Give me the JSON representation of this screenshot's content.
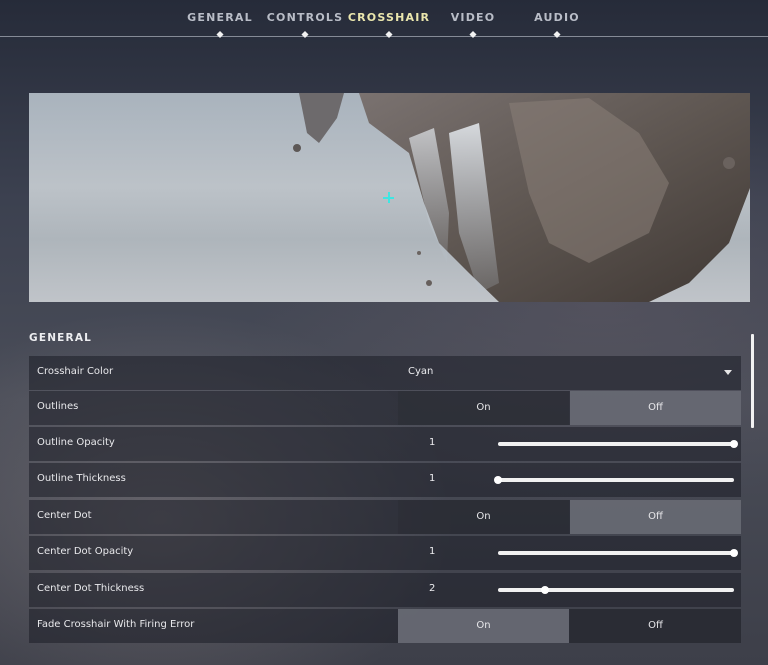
{
  "tabs": [
    {
      "label": "GENERAL",
      "active": false
    },
    {
      "label": "CONTROLS",
      "active": false
    },
    {
      "label": "CROSSHAIR",
      "active": true
    },
    {
      "label": "VIDEO",
      "active": false
    },
    {
      "label": "AUDIO",
      "active": false
    }
  ],
  "crosshair_preview": {
    "crosshair_color": "#3ee6e2"
  },
  "section": {
    "title": "GENERAL"
  },
  "settings": {
    "crosshair_color": {
      "label": "Crosshair Color",
      "value": "Cyan"
    },
    "outlines": {
      "label": "Outlines",
      "on_label": "On",
      "off_label": "Off",
      "selected": "Off"
    },
    "outline_opacity": {
      "label": "Outline Opacity",
      "value": "1",
      "fraction": 1.0
    },
    "outline_thickness": {
      "label": "Outline Thickness",
      "value": "1",
      "fraction": 0.0
    },
    "center_dot": {
      "label": "Center Dot",
      "on_label": "On",
      "off_label": "Off",
      "selected": "Off"
    },
    "center_dot_opacity": {
      "label": "Center Dot Opacity",
      "value": "1",
      "fraction": 1.0
    },
    "center_dot_thickness": {
      "label": "Center Dot Thickness",
      "value": "2",
      "fraction": 0.2
    },
    "fade_crosshair": {
      "label": "Fade Crosshair With Firing Error",
      "on_label": "On",
      "off_label": "Off",
      "selected": "On"
    }
  },
  "colors": {
    "active_tab": "#eae6ad",
    "accent_crosshair": "#3ee6e2"
  }
}
